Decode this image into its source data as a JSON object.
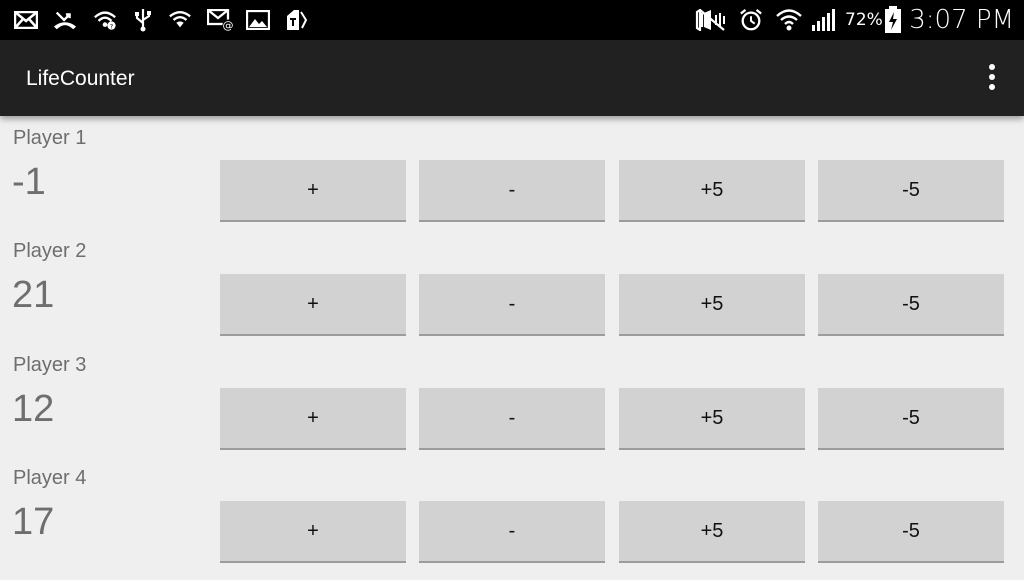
{
  "status_bar": {
    "battery_percent": "72%",
    "time": "3:07 PM",
    "left_icons": [
      "email-icon",
      "missed-call-icon",
      "wifi-notification-icon",
      "usb-icon",
      "wifi-secure-icon",
      "email-at-icon",
      "gallery-icon",
      "carrier-tag-icon"
    ],
    "right_icons": [
      "mute-icon",
      "alarm-icon",
      "wifi-icon",
      "signal-icon",
      "battery-charging-icon"
    ]
  },
  "action_bar": {
    "title": "LifeCounter",
    "overflow_icon": "more-vert-icon"
  },
  "players": [
    {
      "name": "Player 1",
      "life": "-1"
    },
    {
      "name": "Player 2",
      "life": "21"
    },
    {
      "name": "Player 3",
      "life": "12"
    },
    {
      "name": "Player 4",
      "life": "17"
    }
  ],
  "buttons": {
    "plus_one": "+",
    "minus_one": "-",
    "plus_five": "+5",
    "minus_five": "-5"
  }
}
